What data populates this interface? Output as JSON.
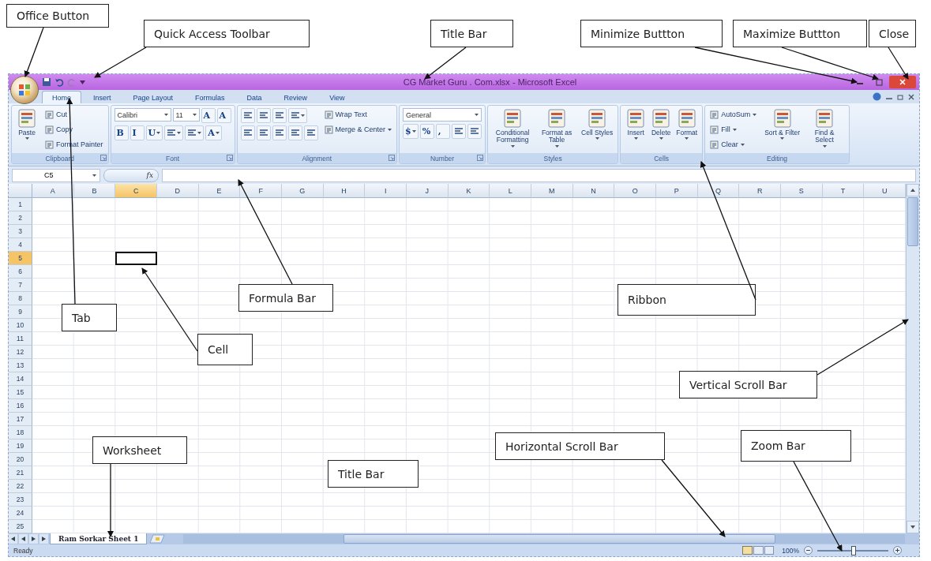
{
  "window": {
    "title": "CG Market Guru . Com.xlsx - Microsoft Excel"
  },
  "tabs": [
    {
      "label": "Home",
      "selected": true
    },
    {
      "label": "Insert",
      "selected": false
    },
    {
      "label": "Page Layout",
      "selected": false
    },
    {
      "label": "Formulas",
      "selected": false
    },
    {
      "label": "Data",
      "selected": false
    },
    {
      "label": "Review",
      "selected": false
    },
    {
      "label": "View",
      "selected": false
    }
  ],
  "ribbon": [
    {
      "label": "Clipboard",
      "launcher": true,
      "columns": [
        [
          [
            {
              "kind": "large",
              "label": "Paste",
              "menu": true
            }
          ]
        ],
        [
          [
            {
              "kind": "small",
              "label": "Cut"
            }
          ],
          [
            {
              "kind": "small",
              "label": "Copy"
            }
          ],
          [
            {
              "kind": "small",
              "label": "Format Painter"
            }
          ]
        ]
      ]
    },
    {
      "label": "Font",
      "launcher": true,
      "columns": [
        [
          [
            {
              "kind": "combo",
              "label": "Calibri"
            },
            {
              "kind": "combo",
              "label": "11"
            },
            {
              "kind": "tool",
              "glyph": "A"
            },
            {
              "kind": "tool",
              "glyph": "A"
            }
          ],
          [
            {
              "kind": "tool",
              "glyph": "B"
            },
            {
              "kind": "tool",
              "glyph": "I"
            },
            {
              "kind": "tool",
              "glyph": "U",
              "menu": true
            },
            {
              "kind": "tool",
              "menu": true
            },
            {
              "kind": "tool",
              "menu": true
            },
            {
              "kind": "tool",
              "glyph": "A",
              "menu": true
            }
          ]
        ]
      ]
    },
    {
      "label": "Alignment",
      "launcher": true,
      "columns": [
        [
          [
            {
              "kind": "tool"
            },
            {
              "kind": "tool"
            },
            {
              "kind": "tool"
            },
            {
              "kind": "tool",
              "menu": true
            }
          ],
          [
            {
              "kind": "tool"
            },
            {
              "kind": "tool"
            },
            {
              "kind": "tool"
            },
            {
              "kind": "tool"
            },
            {
              "kind": "tool"
            }
          ]
        ],
        [
          [
            {
              "kind": "small",
              "label": "Wrap Text"
            }
          ],
          [
            {
              "kind": "small",
              "label": "Merge & Center",
              "menu": true
            }
          ]
        ]
      ]
    },
    {
      "label": "Number",
      "launcher": true,
      "columns": [
        [
          [
            {
              "kind": "combo",
              "label": "General"
            }
          ],
          [
            {
              "kind": "tool",
              "glyph": "$",
              "menu": true
            },
            {
              "kind": "tool",
              "glyph": "%"
            },
            {
              "kind": "tool",
              "glyph": ","
            },
            {
              "kind": "tool"
            },
            {
              "kind": "tool"
            }
          ]
        ]
      ]
    },
    {
      "label": "Styles",
      "launcher": false,
      "columns": [
        [
          [
            {
              "kind": "large",
              "label": "Conditional Formatting",
              "menu": true
            },
            {
              "kind": "large",
              "label": "Format as Table",
              "menu": true
            },
            {
              "kind": "large",
              "label": "Cell Styles",
              "menu": true
            }
          ]
        ]
      ]
    },
    {
      "label": "Cells",
      "launcher": false,
      "columns": [
        [
          [
            {
              "kind": "large",
              "label": "Insert",
              "menu": true
            },
            {
              "kind": "large",
              "label": "Delete",
              "menu": true
            },
            {
              "kind": "large",
              "label": "Format",
              "menu": true
            }
          ]
        ]
      ]
    },
    {
      "label": "Editing",
      "launcher": false,
      "columns": [
        [
          [
            {
              "kind": "small",
              "label": "AutoSum",
              "menu": true
            }
          ],
          [
            {
              "kind": "small",
              "label": "Fill",
              "menu": true
            }
          ],
          [
            {
              "kind": "small",
              "label": "Clear",
              "menu": true
            }
          ]
        ],
        [
          [
            {
              "kind": "large",
              "label": "Sort & Filter",
              "menu": true
            },
            {
              "kind": "large",
              "label": "Find & Select",
              "menu": true
            }
          ]
        ]
      ]
    }
  ],
  "formula_bar": {
    "name_box": "C5",
    "function_label": "fx"
  },
  "sheet": {
    "columns": [
      {
        "label": "A",
        "selected": false
      },
      {
        "label": "B",
        "selected": false
      },
      {
        "label": "C",
        "selected": true
      },
      {
        "label": "D",
        "selected": false
      },
      {
        "label": "E",
        "selected": false
      },
      {
        "label": "F",
        "selected": false
      },
      {
        "label": "G",
        "selected": false
      },
      {
        "label": "H",
        "selected": false
      },
      {
        "label": "I",
        "selected": false
      },
      {
        "label": "J",
        "selected": false
      },
      {
        "label": "K",
        "selected": false
      },
      {
        "label": "L",
        "selected": false
      },
      {
        "label": "M",
        "selected": false
      },
      {
        "label": "N",
        "selected": false
      },
      {
        "label": "O",
        "selected": false
      },
      {
        "label": "P",
        "selected": false
      },
      {
        "label": "Q",
        "selected": false
      },
      {
        "label": "R",
        "selected": false
      },
      {
        "label": "S",
        "selected": false
      },
      {
        "label": "T",
        "selected": false
      },
      {
        "label": "U",
        "selected": false
      }
    ],
    "rows": [
      {
        "label": "1",
        "selected": false
      },
      {
        "label": "2",
        "selected": false
      },
      {
        "label": "3",
        "selected": false
      },
      {
        "label": "4",
        "selected": false
      },
      {
        "label": "5",
        "selected": true
      },
      {
        "label": "6",
        "selected": false
      },
      {
        "label": "7",
        "selected": false
      },
      {
        "label": "8",
        "selected": false
      },
      {
        "label": "9",
        "selected": false
      },
      {
        "label": "10",
        "selected": false
      },
      {
        "label": "11",
        "selected": false
      },
      {
        "label": "12",
        "selected": false
      },
      {
        "label": "13",
        "selected": false
      },
      {
        "label": "14",
        "selected": false
      },
      {
        "label": "15",
        "selected": false
      },
      {
        "label": "16",
        "selected": false
      },
      {
        "label": "17",
        "selected": false
      },
      {
        "label": "18",
        "selected": false
      },
      {
        "label": "19",
        "selected": false
      },
      {
        "label": "20",
        "selected": false
      },
      {
        "label": "21",
        "selected": false
      },
      {
        "label": "22",
        "selected": false
      },
      {
        "label": "23",
        "selected": false
      },
      {
        "label": "24",
        "selected": false
      },
      {
        "label": "25",
        "selected": false
      }
    ]
  },
  "sheet_tabs": [
    {
      "label": "Ram Sorkar Sheet 1",
      "selected": true
    }
  ],
  "status_bar": {
    "text": "Ready",
    "zoom": "100%",
    "zoom_slider": {
      "level": 0.5
    }
  },
  "annotations": [
    {
      "label": "Office Button"
    },
    {
      "label": "Quick Access Toolbar"
    },
    {
      "label": "Title Bar"
    },
    {
      "label": "Minimize Buttton"
    },
    {
      "label": "Maximize Buttton"
    },
    {
      "label": "Close"
    },
    {
      "label": "Formula Bar"
    },
    {
      "label": "Ribbon"
    },
    {
      "label": "Tab"
    },
    {
      "label": "Cell"
    },
    {
      "label": "Vertical Scroll Bar"
    },
    {
      "label": "Worksheet"
    },
    {
      "label": "Horizontal Scroll Bar"
    },
    {
      "label": "Zoom Bar"
    },
    {
      "label": "Title Bar"
    }
  ]
}
